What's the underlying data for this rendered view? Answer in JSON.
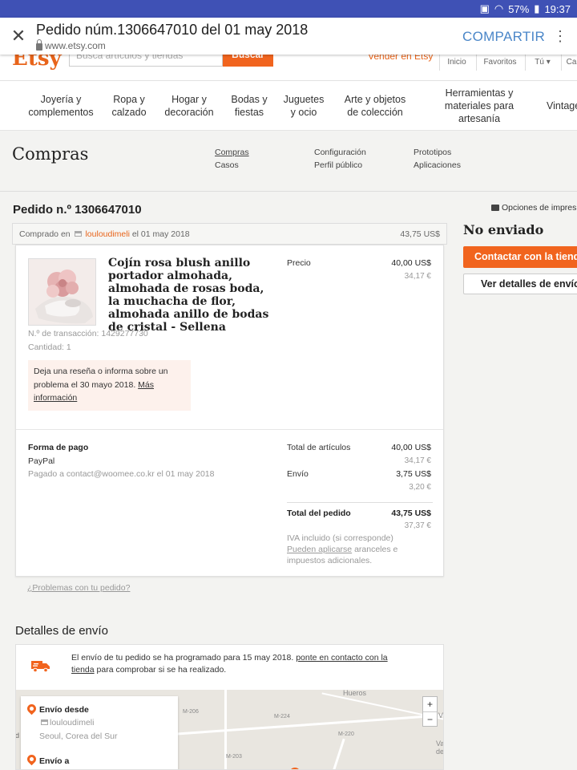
{
  "status_bar": {
    "battery": "57%",
    "time": "19:37"
  },
  "tab": {
    "title": "Pedido núm.1306647010 del 01 may 2018",
    "url": "www.etsy.com",
    "share_label": "COMPARTIR"
  },
  "etsy_header": {
    "logo": "Etsy",
    "search_placeholder": "Busca artículos y tiendas",
    "search_button": "Buscar",
    "sell_link": "Vender en Etsy",
    "nav": [
      "Inicio",
      "Favoritos",
      "Tú",
      "Ca"
    ]
  },
  "categories": [
    "Joyería y complementos",
    "Ropa y calzado",
    "Hogar y decoración",
    "Bodas y fiestas",
    "Juguetes y ocio",
    "Arte y objetos de colección",
    "Herramientas y materiales para artesanía",
    "Vintage"
  ],
  "purchases": {
    "title": "Compras",
    "links": [
      "Compras",
      "Casos",
      "Configuración",
      "Perfil público",
      "Prototipos",
      "Aplicaciones"
    ]
  },
  "order": {
    "id_label": "Pedido n.º 1306647010",
    "print_options": "Opciones de impres",
    "bought_prefix": "Comprado en",
    "shop": "louloudimeli",
    "bought_date": "el 01 may 2018",
    "bought_total": "43,75 US$",
    "product_title": "Cojín rosa blush anillo portador almohada, almohada de rosas boda, la muchacha de flor, almohada anillo de bodas de cristal - Sellena",
    "price_label": "Precio",
    "price_usd": "40,00 US$",
    "price_eur": "34,17 €",
    "transaction": "N.º de transacción: 1429277730",
    "quantity": "Cantidad: 1",
    "review_text": "Deja una reseña o informa sobre un problema el 30 mayo 2018.",
    "review_link": "Más información",
    "payment_title": "Forma de pago",
    "payment_method": "PayPal",
    "payment_to": "Pagado a contact@woomee.co.kr el 01 may 2018",
    "items_total_label": "Total de artículos",
    "items_total_usd": "40,00 US$",
    "items_total_eur": "34,17 €",
    "shipping_label": "Envío",
    "shipping_usd": "3,75 US$",
    "shipping_eur": "3,20 €",
    "order_total_label": "Total del pedido",
    "order_total_usd": "43,75 US$",
    "order_total_eur": "37,37 €",
    "iva_note": "IVA incluido (si corresponde)",
    "duties_link": "Pueden aplicarse",
    "duties_rest": "aranceles e impuestos adicionales.",
    "problems_link": "¿Problemas con tu pedido?"
  },
  "sidebar": {
    "status": "No enviado",
    "contact_button": "Contactar con la tienda",
    "details_button": "Ver detalles de envío"
  },
  "shipping": {
    "title": "Detalles de envío",
    "message_before": "El envío de tu pedido se ha programado para 15 may 2018.",
    "message_link": "ponte en contacto con la tienda",
    "message_after": "para comprobar si se ha realizado.",
    "from_label": "Envío desde",
    "from_shop": "louloudimeli",
    "from_location": "Seoul, Corea del Sur",
    "to_label": "Envío a",
    "map_labels": [
      "Hueros",
      "M-206",
      "M-224",
      "M-220",
      "M-203",
      "Vi",
      "Va de"
    ],
    "zoom_in": "+",
    "zoom_out": "−"
  },
  "colors": {
    "etsy_orange": "#f1641e",
    "status_bar": "#3f51b5",
    "share_blue": "#4a86c8"
  }
}
